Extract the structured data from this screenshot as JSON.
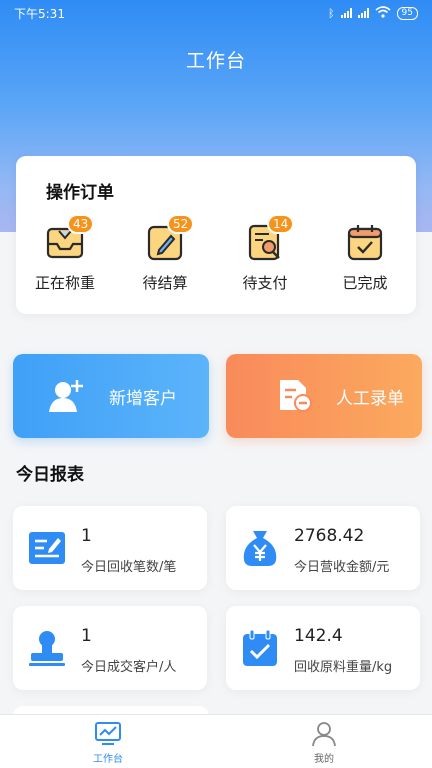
{
  "status_bar": {
    "time": "下午5:31",
    "battery": "95"
  },
  "header": {
    "title": "工作台"
  },
  "orders": {
    "title": "操作订单",
    "items": [
      {
        "label": "正在称重",
        "badge": "43",
        "icon": "weighing-tray-icon"
      },
      {
        "label": "待结算",
        "badge": "52",
        "icon": "pencil-note-icon"
      },
      {
        "label": "待支付",
        "badge": "14",
        "icon": "document-search-icon"
      },
      {
        "label": "已完成",
        "badge": "",
        "icon": "calendar-check-icon"
      }
    ]
  },
  "actions": {
    "add_customer": "新增客户",
    "manual_entry": "人工录单"
  },
  "report": {
    "title": "今日报表",
    "stats": [
      {
        "value": "1",
        "label": "今日回收笔数/笔",
        "icon": "form-edit-icon"
      },
      {
        "value": "2768.42",
        "label": "今日营收金额/元",
        "icon": "money-bag-icon"
      },
      {
        "value": "1",
        "label": "今日成交客户/人",
        "icon": "stamp-icon"
      },
      {
        "value": "142.4",
        "label": "回收原料重量/kg",
        "icon": "calendar-check-icon"
      }
    ]
  },
  "tabbar": {
    "workbench": "工作台",
    "mine": "我的"
  },
  "colors": {
    "primary": "#2f8cf5",
    "badge": "#f7931a",
    "orange": "#f98a5b"
  }
}
